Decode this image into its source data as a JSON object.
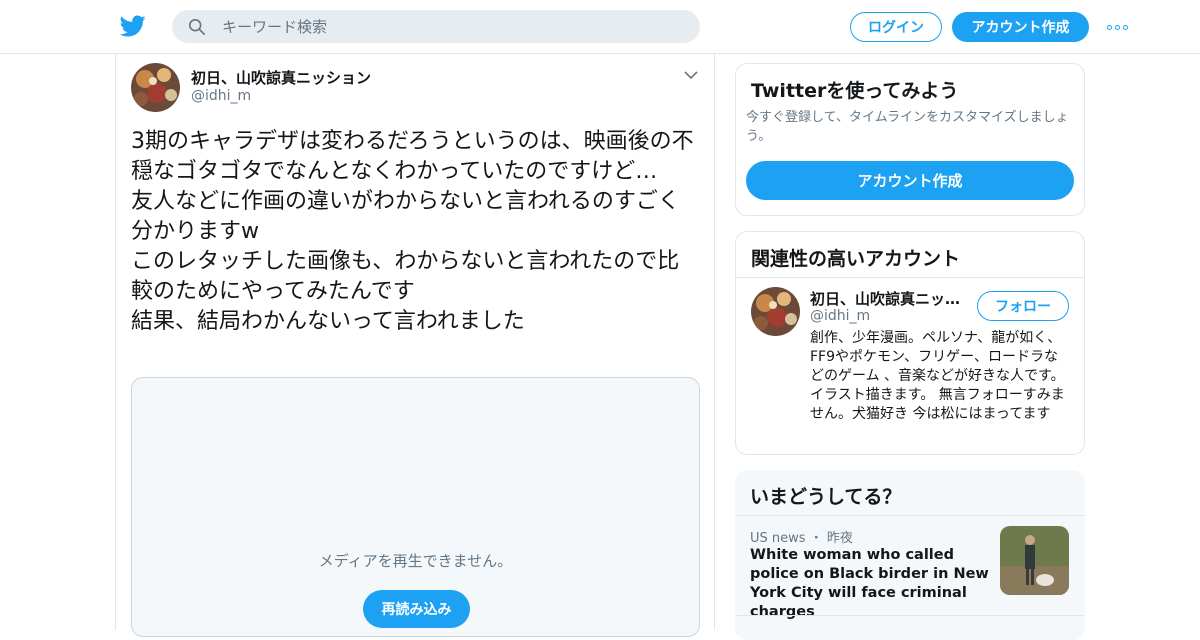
{
  "header": {
    "search_placeholder": "キーワード検索",
    "login_label": "ログイン",
    "signup_label": "アカウント作成",
    "brand_color": "#1da1f2"
  },
  "tweet": {
    "author_name": "初日、山吹諒真ニッション",
    "author_handle": "@idhi_m",
    "text": "3期のキャラデザは変わるだろうというのは、映画後の不穏なゴタゴタでなんとなくわかっていたのですけど…\n友人などに作画の違いがわからないと言われるのすごく分かりますw\nこのレタッチした画像も、わからないと言われたので比較のためにやってみたんです\n結果、結局わかんないって言われました",
    "media_message": "メディアを再生できません。",
    "reload_label": "再読み込み"
  },
  "sidebar": {
    "signup_card": {
      "title": "Twitterを使ってみよう",
      "description": "今すぐ登録して、タイムラインをカスタマイズしましょう。",
      "button_label": "アカウント作成"
    },
    "related": {
      "title": "関連性の高いアカウント",
      "account": {
        "name": "初日、山吹諒真ニッション",
        "handle": "@idhi_m",
        "follow_label": "フォロー",
        "bio": "創作、少年漫画。ペルソナ、龍が如く、FF9やポケモン、フリゲー、ロードラなどのゲーム 、音楽などが好きな人です。 イラスト描きます。 無言フォローすみません。犬猫好き 今は松にはまってます"
      }
    },
    "trends": {
      "title": "いまどうしてる？",
      "item": {
        "category": "US news",
        "separator": "・",
        "time": "昨夜",
        "headline": "White woman who called police on Black birder in New York City will face criminal charges"
      }
    }
  }
}
